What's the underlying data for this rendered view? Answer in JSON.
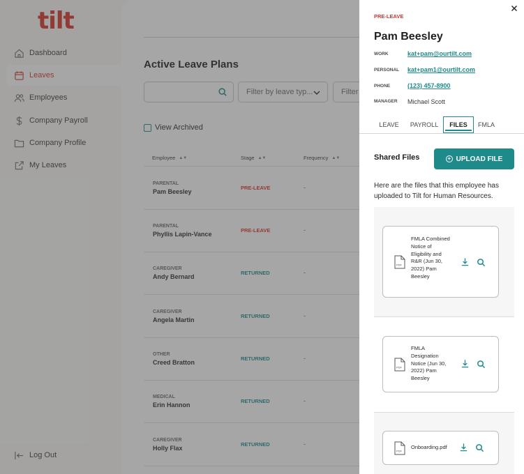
{
  "app": {
    "logo": "tilt"
  },
  "colors": {
    "brand": "#d8322a",
    "accent": "#1f8a8a"
  },
  "sidebar": {
    "items": [
      {
        "label": "Dashboard",
        "icon": "home-icon"
      },
      {
        "label": "Leaves",
        "icon": "calendar-icon",
        "active": true
      },
      {
        "label": "Employees",
        "icon": "users-icon"
      },
      {
        "label": "Company Payroll",
        "icon": "dollar-icon"
      },
      {
        "label": "Company Profile",
        "icon": "folder-icon"
      },
      {
        "label": "My Leaves",
        "icon": "external-link-icon"
      }
    ],
    "logout": "Log Out"
  },
  "main": {
    "title": "Active Leave Plans",
    "search": {
      "placeholder": ""
    },
    "filters": [
      "Filter by leave typ...",
      "Filter"
    ],
    "view_archived": "View Archived",
    "columns": [
      "Employee",
      "Stage",
      "Frequency"
    ],
    "rows": [
      {
        "type": "PARENTAL",
        "name": "Pam Beesley",
        "stage": "PRE-LEAVE",
        "frequency": "-"
      },
      {
        "type": "PARENTAL",
        "name": "Phyllis Lapin-Vance",
        "stage": "PRE-LEAVE",
        "frequency": "-"
      },
      {
        "type": "CAREGIVER",
        "name": "Andy Bernard",
        "stage": "RETURNED",
        "frequency": "-"
      },
      {
        "type": "CAREGIVER",
        "name": "Angela Martin",
        "stage": "RETURNED",
        "frequency": "-"
      },
      {
        "type": "OTHER",
        "name": "Creed Bratton",
        "stage": "RETURNED",
        "frequency": "-"
      },
      {
        "type": "MEDICAL",
        "name": "Erin Hannon",
        "stage": "RETURNED",
        "frequency": "-"
      },
      {
        "type": "CAREGIVER",
        "name": "Holly Flax",
        "stage": "RETURNED",
        "frequency": "-"
      }
    ]
  },
  "drawer": {
    "stage": "PRE-LEAVE",
    "name": "Pam Beesley",
    "work_label": "WORK",
    "work_email": "kat+pam@ourtilt.com",
    "personal_label": "PERSONAL",
    "personal_email": "kat+pam1@ourtilt.com",
    "phone_label": "PHONE",
    "phone": "(123) 457-8900",
    "manager_label": "MANAGER",
    "manager": "Michael Scott",
    "tabs": [
      "LEAVE",
      "PAYROLL",
      "FILES",
      "FMLA"
    ],
    "active_tab": "FILES",
    "shared_files_title": "Shared Files",
    "upload_label": "UPLOAD FILE",
    "description": "Here are the files that this employee has uploaded to Tilt for Human Resources.",
    "files": [
      {
        "name": "FMLA Combined Notice of Eligibility and R&R (Jun 30, 2022) Pam Beesley"
      },
      {
        "name": "FMLA Designation Notice (Jun 30, 2022) Pam Beesley"
      },
      {
        "name": "Onboarding.pdf"
      }
    ]
  }
}
